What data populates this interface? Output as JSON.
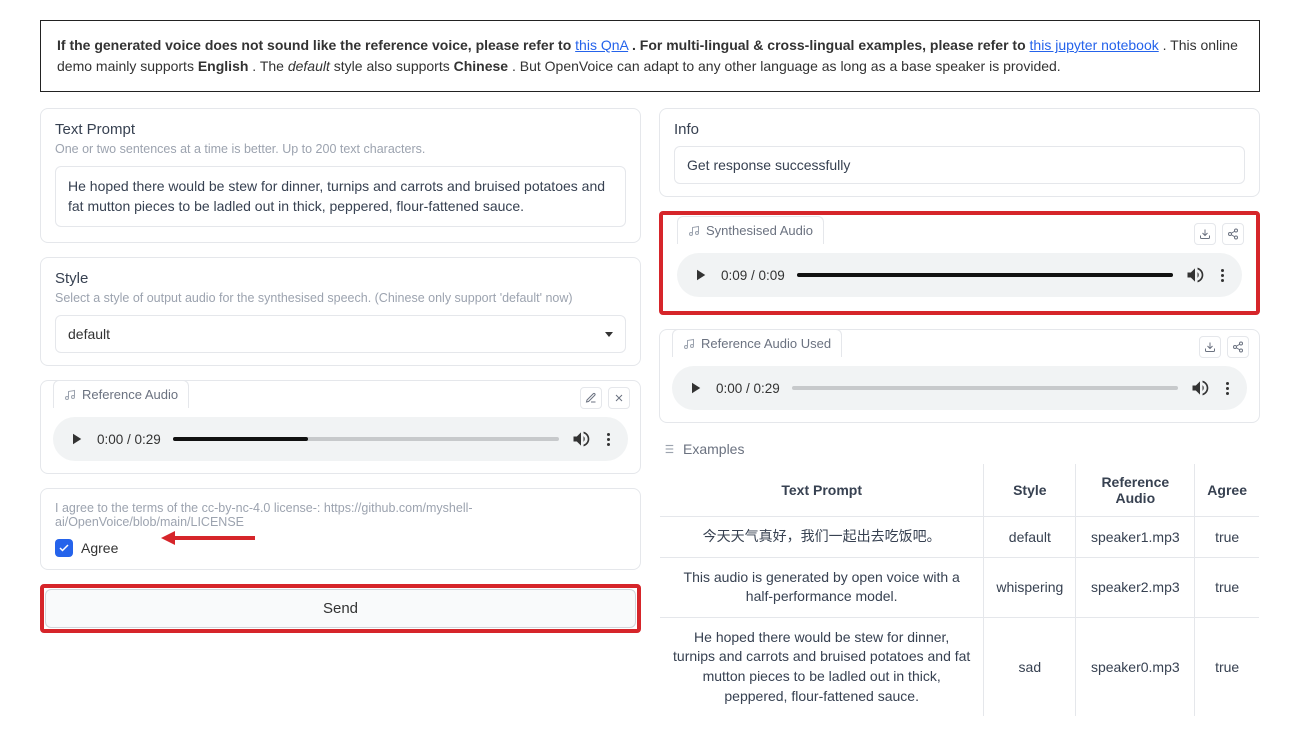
{
  "notice": {
    "pre1": "If the generated voice does not sound like the reference voice, please refer to ",
    "link1": "this QnA",
    "post1": ". For multi-lingual & cross-lingual examples, please refer to ",
    "link2": "this jupyter notebook",
    "post2": ". This online demo mainly supports ",
    "bold1": "English",
    "post3": ". The ",
    "em1": "default",
    "post4": " style also supports ",
    "bold2": "Chinese",
    "post5": ". But OpenVoice can adapt to any other language as long as a base speaker is provided."
  },
  "left": {
    "text_prompt": {
      "title": "Text Prompt",
      "sub": "One or two sentences at a time is better. Up to 200 text characters.",
      "value": "He hoped there would be stew for dinner, turnips and carrots and bruised potatoes and fat mutton pieces to be ladled out in thick, peppered, flour-fattened sauce."
    },
    "style": {
      "title": "Style",
      "sub": "Select a style of output audio for the synthesised speech. (Chinese only support 'default' now)",
      "value": "default"
    },
    "ref_audio": {
      "label": "Reference Audio",
      "time": "0:00 / 0:29",
      "progress_pct": 35
    },
    "agree": {
      "text": "I agree to the terms of the cc-by-nc-4.0 license-: https://github.com/myshell-ai/OpenVoice/blob/main/LICENSE",
      "label": "Agree",
      "checked": true
    },
    "send_label": "Send"
  },
  "right": {
    "info": {
      "title": "Info",
      "value": "Get response successfully"
    },
    "synth": {
      "label": "Synthesised Audio",
      "time": "0:09 / 0:09",
      "progress_pct": 100
    },
    "ref_used": {
      "label": "Reference Audio Used",
      "time": "0:00 / 0:29",
      "progress_pct": 0
    },
    "examples_title": "Examples",
    "examples_headers": [
      "Text Prompt",
      "Style",
      "Reference Audio",
      "Agree"
    ],
    "examples": [
      {
        "prompt": "今天天气真好，我们一起出去吃饭吧。",
        "style": "default",
        "ref": "speaker1.mp3",
        "agree": "true"
      },
      {
        "prompt": "This audio is generated by open voice with a half-performance model.",
        "style": "whispering",
        "ref": "speaker2.mp3",
        "agree": "true"
      },
      {
        "prompt": "He hoped there would be stew for dinner, turnips and carrots and bruised potatoes and fat mutton pieces to be ladled out in thick, peppered, flour-fattened sauce.",
        "style": "sad",
        "ref": "speaker0.mp3",
        "agree": "true"
      }
    ]
  }
}
